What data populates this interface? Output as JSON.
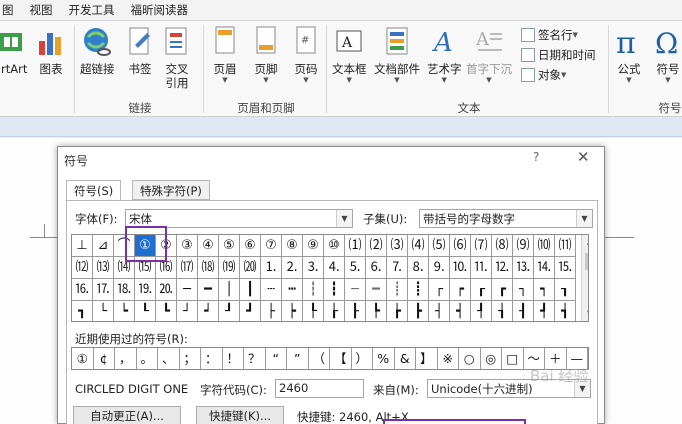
{
  "menu": [
    "图",
    "视图",
    "开发工具",
    "福昕阅读器"
  ],
  "ribbon": {
    "buttons": [
      {
        "label": "artArt",
        "icon": "smartart-icon"
      },
      {
        "label": "图表",
        "icon": "chart-icon"
      },
      {
        "label": "超链接",
        "icon": "hyperlink-icon"
      },
      {
        "label": "书签",
        "icon": "bookmark-icon"
      },
      {
        "label": "交叉引用",
        "icon": "cross-reference-icon"
      },
      {
        "label": "页眉",
        "icon": "header-icon"
      },
      {
        "label": "页脚",
        "icon": "footer-icon"
      },
      {
        "label": "页码",
        "icon": "page-number-icon"
      },
      {
        "label": "文本框",
        "icon": "textbox-icon"
      },
      {
        "label": "文档部件",
        "icon": "quick-parts-icon"
      },
      {
        "label": "艺术字",
        "icon": "wordart-icon"
      },
      {
        "label": "首字下沉",
        "icon": "drop-cap-icon"
      },
      {
        "label": "公式",
        "icon": "equation-icon"
      },
      {
        "label": "符号",
        "icon": "symbol-icon"
      }
    ],
    "small": [
      "签名行",
      "日期和时间",
      "对象"
    ],
    "groups": [
      "链接",
      "页眉和页脚",
      "文本",
      "符号"
    ]
  },
  "dialog": {
    "title": "符号",
    "help": "?",
    "close": "✕",
    "tabs": [
      "符号(S)",
      "特殊字符(P)"
    ],
    "font_label": "字体(F):",
    "font_value": "宋体",
    "subset_label": "子集(U):",
    "subset_value": "带括号的字母数字",
    "grid_rows": [
      [
        "⊥",
        "⊿",
        "⌒",
        "①",
        "②",
        "③",
        "④",
        "⑤",
        "⑥",
        "⑦",
        "⑧",
        "⑨",
        "⑩",
        "⑴",
        "⑵",
        "⑶",
        "⑷",
        "⑸",
        "⑹",
        "⑺",
        "⑻",
        "⑼",
        "⑽",
        "⑾"
      ],
      [
        "⑿",
        "⒀",
        "⒁",
        "⒂",
        "⒃",
        "⒄",
        "⒅",
        "⒆",
        "⒇",
        "⒈",
        "⒉",
        "⒊",
        "⒋",
        "⒌",
        "⒍",
        "⒎",
        "⒏",
        "⒐",
        "⒑",
        "⒒",
        "⒓",
        "⒔",
        "⒕",
        "⒖"
      ],
      [
        "⒗",
        "⒘",
        "⒙",
        "⒚",
        "⒛",
        "─",
        "━",
        "│",
        "┃",
        "┄",
        "┅",
        "┆",
        "┇",
        "┈",
        "┉",
        "┊",
        "┋",
        "┌",
        "┍",
        "┎",
        "┏",
        "┐",
        "┑",
        "┒"
      ],
      [
        "┓",
        "└",
        "┕",
        "┖",
        "┗",
        "┘",
        "┙",
        "┚",
        "┛",
        "├",
        "┝",
        "┞",
        "┟",
        "┠",
        "┡",
        "┢",
        "┣",
        "┤",
        "┥",
        "┦",
        "┧",
        "┨",
        "┩",
        "┪"
      ]
    ],
    "recent_label": "近期使用过的符号(R):",
    "recent": [
      "①",
      "¢",
      "，",
      "。",
      "、",
      "；",
      "：",
      "！",
      "？",
      "“",
      "”",
      "（",
      "【",
      "）",
      "%",
      "&",
      "】",
      "※",
      "○",
      "◎",
      "□",
      "～",
      "＋",
      "—"
    ],
    "char_name": "CIRCLED DIGIT ONE",
    "code_label": "字符代码(C):",
    "code_value": "2460",
    "from_label": "来自(M):",
    "from_value": "Unicode(十六进制)",
    "autocorrect_button": "自动更正(A)...",
    "shortcut_button": "快捷键(K)...",
    "shortcut_text": "快捷键: 2460, Alt+X"
  },
  "colors": {
    "highlight": "#7b2fa8",
    "selected": "#1f6fd1"
  },
  "watermark": "Bai 经验"
}
